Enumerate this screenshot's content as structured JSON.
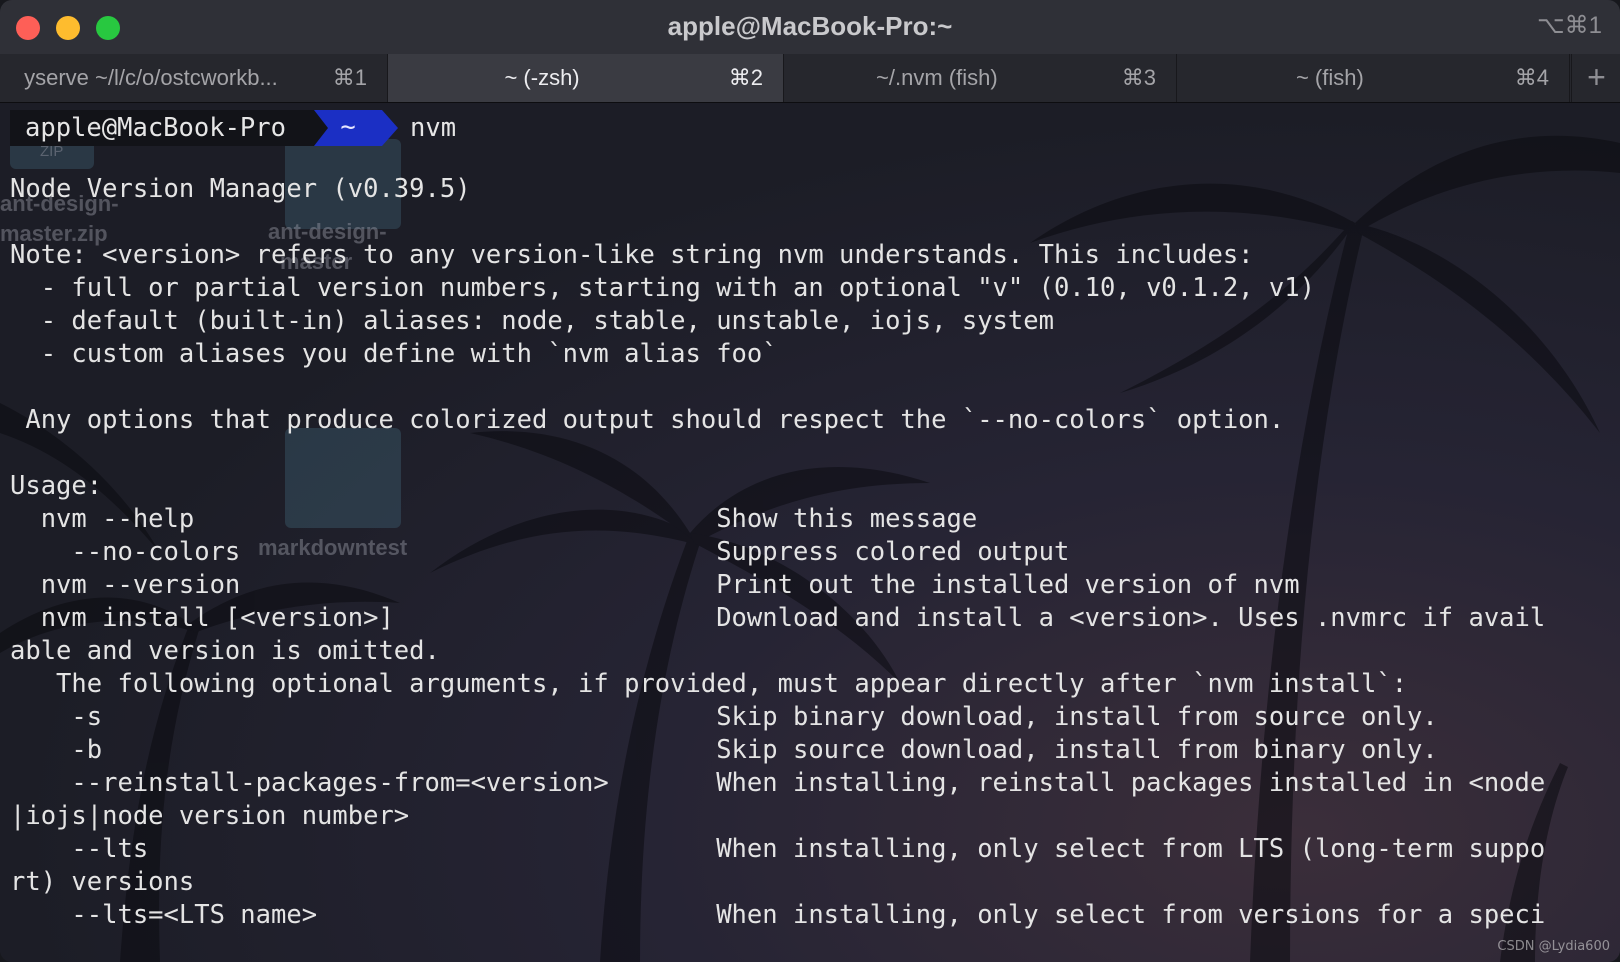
{
  "window": {
    "title": "apple@MacBook-Pro:~",
    "shortcut": "⌥⌘1"
  },
  "tabs": [
    {
      "label": "yserve ~/l/c/o/ostcworkb...",
      "shortcut": "⌘1",
      "active": false
    },
    {
      "label": "~ (-zsh)",
      "shortcut": "⌘2",
      "active": true
    },
    {
      "label": "~/.nvm (fish)",
      "shortcut": "⌘3",
      "active": false
    },
    {
      "label": "~ (fish)",
      "shortcut": "⌘4",
      "active": false
    }
  ],
  "new_tab_label": "+",
  "prompt": {
    "user_host": "apple@MacBook-Pro",
    "dir": "~",
    "command": "nvm"
  },
  "desktop_labels": {
    "zip_tag": "ZIP",
    "file1_line1": "ant-design-",
    "file1_line2": "master.zip",
    "file2_line1": "ant-design-",
    "file2_line2": "master",
    "folder": "markdowntest"
  },
  "output_lines": [
    "Node Version Manager (v0.39.5)",
    "",
    "Note: <version> refers to any version-like string nvm understands. This includes:",
    "  - full or partial version numbers, starting with an optional \"v\" (0.10, v0.1.2, v1)",
    "  - default (built-in) aliases: node, stable, unstable, iojs, system",
    "  - custom aliases you define with `nvm alias foo`",
    "",
    " Any options that produce colorized output should respect the `--no-colors` option.",
    "",
    "Usage:",
    "  nvm --help                                  Show this message",
    "    --no-colors                               Suppress colored output",
    "  nvm --version                               Print out the installed version of nvm",
    "  nvm install [<version>]                     Download and install a <version>. Uses .nvmrc if avail",
    "able and version is omitted.",
    "   The following optional arguments, if provided, must appear directly after `nvm install`:",
    "    -s                                        Skip binary download, install from source only.",
    "    -b                                        Skip source download, install from binary only.",
    "    --reinstall-packages-from=<version>       When installing, reinstall packages installed in <node",
    "|iojs|node version number>",
    "    --lts                                     When installing, only select from LTS (long-term suppo",
    "rt) versions",
    "    --lts=<LTS name>                          When installing, only select from versions for a speci"
  ],
  "watermark": "CSDN @Lydia600"
}
